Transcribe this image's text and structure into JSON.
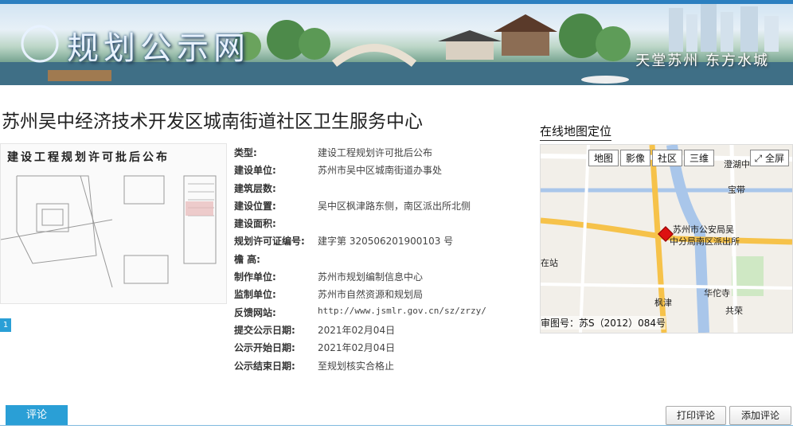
{
  "banner": {
    "site_title": "规划公示网",
    "slogan": "天堂苏州 东方水城"
  },
  "page_title": "苏州吴中经济技术开发区城南街道社区卫生服务中心",
  "document": {
    "heading": "建设工程规划许可批后公布",
    "page_number": "1"
  },
  "info_rows": [
    {
      "label": "类型:",
      "value": "建设工程规划许可批后公布"
    },
    {
      "label": "建设单位:",
      "value": "苏州市吴中区城南街道办事处"
    },
    {
      "label": "建筑层数:",
      "value": ""
    },
    {
      "label": "建设位置:",
      "value": "吴中区枫津路东侧，南区派出所北侧"
    },
    {
      "label": "建设面积:",
      "value": ""
    },
    {
      "label": "规划许可证编号:",
      "value": "建字第 320506201900103 号"
    },
    {
      "label": "檐 高:",
      "value": ""
    },
    {
      "label": "制作单位:",
      "value": "苏州市规划编制信息中心"
    },
    {
      "label": "监制单位:",
      "value": "苏州市自然资源和规划局"
    },
    {
      "label": "反馈网站:",
      "value": "http://www.jsmlr.gov.cn/sz/zrzy/"
    },
    {
      "label": "提交公示日期:",
      "value": "2021年02月04日"
    },
    {
      "label": "公示开始日期:",
      "value": "2021年02月04日"
    },
    {
      "label": "公示结束日期:",
      "value": "至规划核实合格止"
    }
  ],
  "map": {
    "heading": "在线地图定位",
    "buttons": [
      "地图",
      "影像",
      "社区",
      "三维"
    ],
    "fullscreen": "全屏",
    "labels": {
      "poi_line1": "苏州市公安局吴",
      "poi_line2": "中分局南区派出所",
      "temple": "华佗寺",
      "station": "在站",
      "road_top": "澄湖中",
      "vertical_left": "枫津",
      "vertical_right1": "宝带",
      "vertical_right2": "共荣"
    },
    "caption": "审图号：苏S（2012）084号"
  },
  "comments": {
    "tab_label": "评论",
    "print_label": "打印评论",
    "add_label": "添加评论"
  },
  "colors": {
    "accent": "#2a9fd6"
  }
}
